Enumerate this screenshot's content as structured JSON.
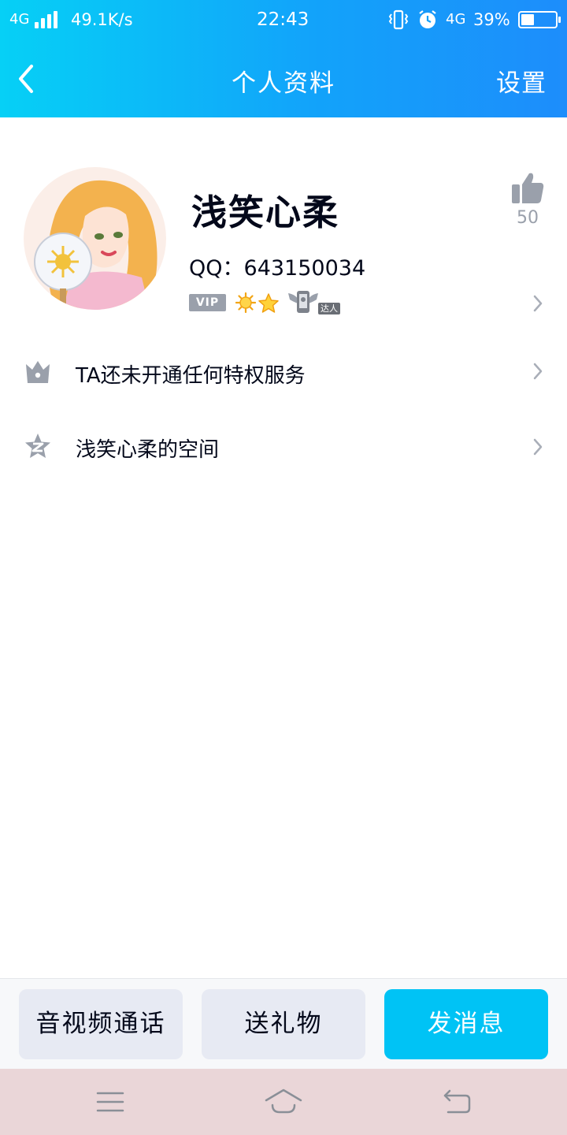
{
  "status_bar": {
    "network_left": "4G",
    "speed": "49.1K/s",
    "time": "22:43",
    "network_right": "4G",
    "battery": "39%",
    "battery_level": 0.39
  },
  "nav": {
    "title": "个人资料",
    "settings_label": "设置"
  },
  "profile": {
    "name": "浅笑心柔",
    "qq_label": "QQ：",
    "qq_number": "643150034",
    "vip_badge": "VIP",
    "daren_badge": "达人",
    "like_count": "50"
  },
  "list": {
    "privilege_text": "TA还未开通任何特权服务",
    "space_text": "浅笑心柔的空间"
  },
  "actions": {
    "call_label": "音视频通话",
    "gift_label": "送礼物",
    "message_label": "发消息"
  },
  "colors": {
    "accent": "#00c3f5",
    "header_start": "#06d0f6",
    "header_end": "#1d8dfb",
    "icon_gray": "#9aa0ab"
  }
}
